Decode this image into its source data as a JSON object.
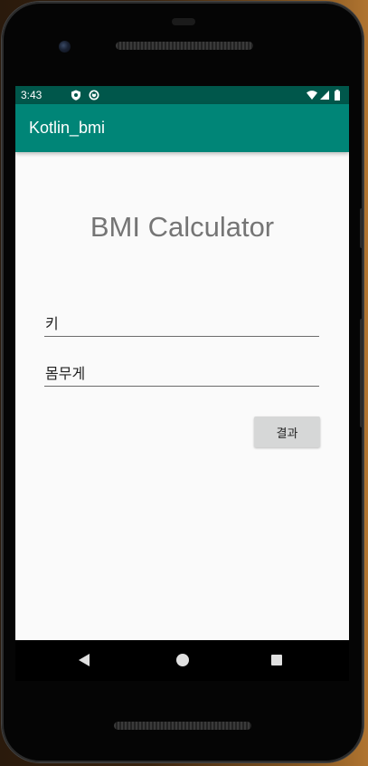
{
  "status_bar": {
    "time": "3:43",
    "left_icons": [
      "shield-icon",
      "sync-icon"
    ],
    "right_icons": [
      "wifi-icon",
      "signal-icon",
      "battery-icon"
    ],
    "color": "#00574b"
  },
  "app_bar": {
    "title": "Kotlin_bmi",
    "color": "#008577"
  },
  "main": {
    "heading": "BMI Calculator",
    "height_field": {
      "placeholder": "키",
      "value": ""
    },
    "weight_field": {
      "placeholder": "몸무게",
      "value": ""
    },
    "result_button_label": "결과"
  },
  "nav_bar": {
    "buttons": [
      "back-icon",
      "home-icon",
      "recents-icon"
    ]
  }
}
